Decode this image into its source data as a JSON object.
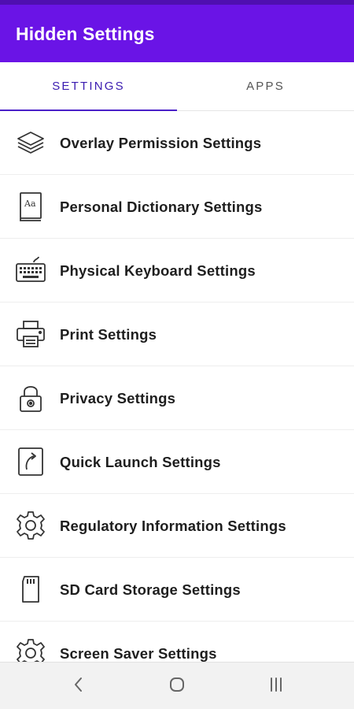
{
  "app": {
    "title": "Hidden Settings"
  },
  "tabs": [
    {
      "label": "SETTINGS",
      "selected": true
    },
    {
      "label": "APPS",
      "selected": false
    }
  ],
  "settings": [
    {
      "label": "Overlay Permission Settings",
      "icon": "layers-icon"
    },
    {
      "label": "Personal Dictionary Settings",
      "icon": "dictionary-icon"
    },
    {
      "label": "Physical Keyboard Settings",
      "icon": "keyboard-icon"
    },
    {
      "label": "Print Settings",
      "icon": "printer-icon"
    },
    {
      "label": "Privacy Settings",
      "icon": "lock-icon"
    },
    {
      "label": "Quick Launch Settings",
      "icon": "quick-launch-icon"
    },
    {
      "label": "Regulatory Information Settings",
      "icon": "gear-icon"
    },
    {
      "label": "SD Card Storage Settings",
      "icon": "sd-card-icon"
    },
    {
      "label": "Screen Saver Settings",
      "icon": "gear-icon"
    }
  ],
  "navigation": {
    "back": "back-icon",
    "home": "home-icon",
    "recents": "recents-icon"
  },
  "colors": {
    "appbar": "#6a14e6",
    "tab_selected": "#3a1bb0",
    "tab_indicator": "#4a20c8"
  }
}
